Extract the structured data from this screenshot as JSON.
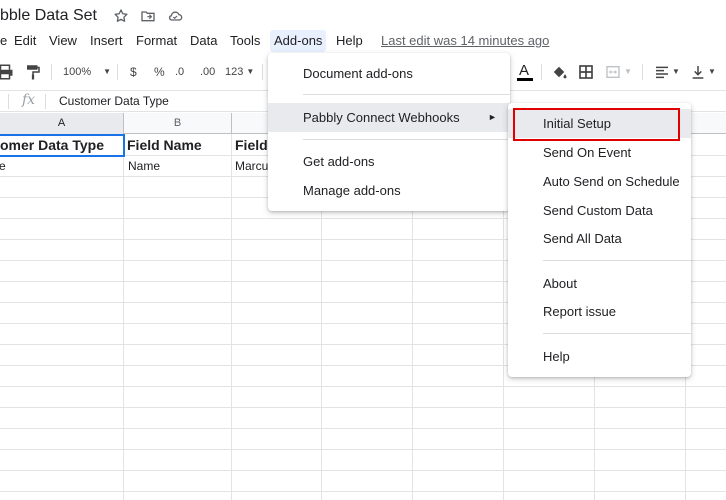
{
  "title": {
    "doc_name": "bble Data Set"
  },
  "menubar": {
    "items": [
      "e",
      "Edit",
      "View",
      "Insert",
      "Format",
      "Data",
      "Tools",
      "Add-ons",
      "Help"
    ],
    "last_edit": "Last edit was 14 minutes ago"
  },
  "toolbar": {
    "zoom": "100%",
    "currency": "$",
    "percent": "%",
    "dec_decrease": ".0",
    "dec_increase": ".00",
    "format_123": "123"
  },
  "formula_bar": {
    "fx": "fx",
    "content": "Customer Data Type"
  },
  "columns": [
    "A",
    "B"
  ],
  "cells": {
    "a1": "omer Data Type",
    "b1": "Field Name",
    "c1": "Field",
    "a2": "e",
    "b2": "Name",
    "c2": "Marcu"
  },
  "addons_menu": {
    "items": [
      "Document add-ons",
      "Pabbly Connect Webhooks",
      "Get add-ons",
      "Manage add-ons"
    ]
  },
  "submenu": {
    "items": [
      "Initial Setup",
      "Send On Event",
      "Auto Send on Schedule",
      "Send Custom Data",
      "Send All Data",
      "About",
      "Report issue",
      "Help"
    ]
  },
  "colors": {
    "accent_blue": "#1a73e8",
    "highlight_red": "#e00000"
  },
  "icons": [
    "star-icon",
    "move-folder-icon",
    "cloud-saved-icon",
    "print-icon",
    "paint-format-icon",
    "text-color-icon",
    "fill-color-icon",
    "borders-icon",
    "merge-cells-icon",
    "align-left-icon",
    "vertical-align-icon",
    "submenu-arrow-icon"
  ]
}
